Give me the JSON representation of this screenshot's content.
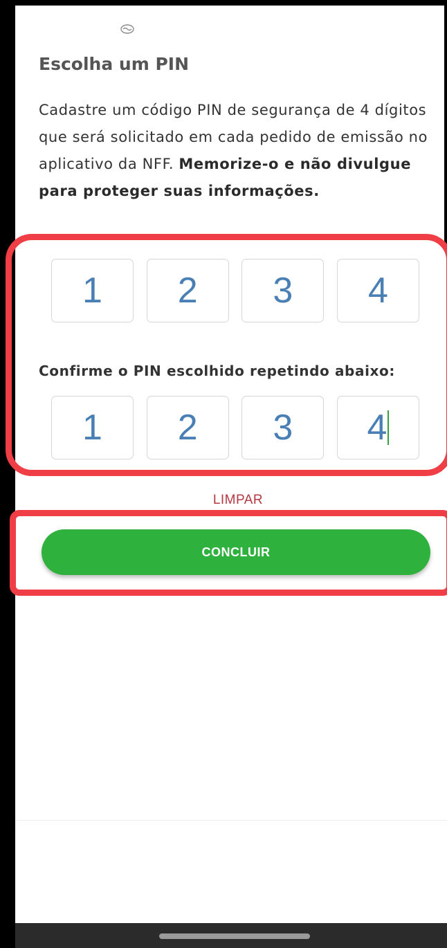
{
  "screen": {
    "title": "Escolha um PIN",
    "description_plain": "Cadastre um código PIN de segurança de 4 dígitos que será solicitado em cada pedido de emissão no aplicativo da NFF. ",
    "description_bold": "Memorize-o e não divulgue para proteger suas informações.",
    "logo_icon": "handshake-icon"
  },
  "pin": {
    "digits": [
      "1",
      "2",
      "3",
      "4"
    ]
  },
  "confirm": {
    "label": "Confirme o PIN escolhido repetindo abaixo:",
    "digits": [
      "1",
      "2",
      "3",
      "4"
    ]
  },
  "actions": {
    "clear_label": "LIMPAR",
    "submit_label": "CONCLUIR"
  },
  "colors": {
    "accent_green": "#2eb13d",
    "clear_red": "#b43840",
    "digit_blue": "#4a7fb5",
    "highlight_red": "#ef3e45"
  }
}
